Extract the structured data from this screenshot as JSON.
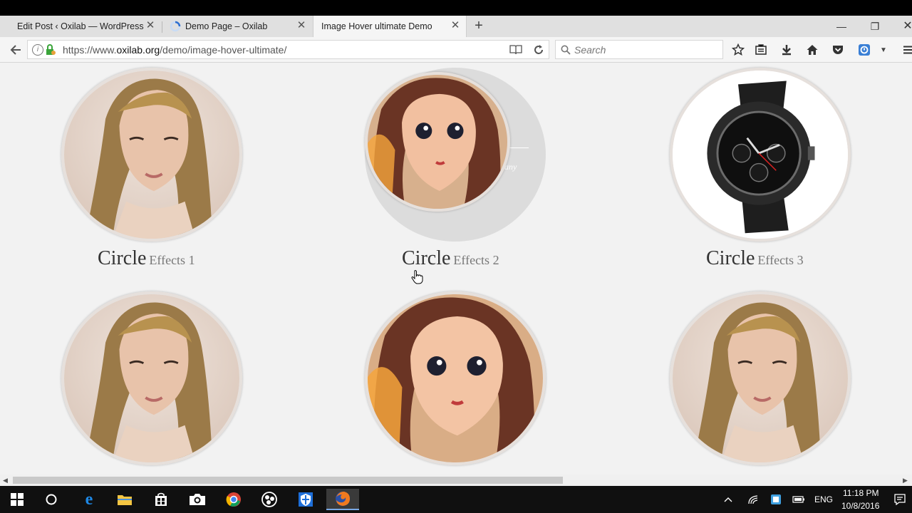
{
  "tabs": [
    {
      "title": "Edit Post ‹ Oxilab — WordPress"
    },
    {
      "title": "Demo Page – Oxilab"
    },
    {
      "title": "Image Hover ultimate Demo"
    }
  ],
  "toolbar": {
    "url_prefix": "https://www.",
    "url_domain": "oxilab.org",
    "url_path": "/demo/image-hover-ultimate/",
    "search_placeholder": "Search"
  },
  "items": [
    {
      "title": "Circle",
      "subtitle": "Effects 1"
    },
    {
      "title": "Circle",
      "subtitle": "Effects 2"
    },
    {
      "title": "Circle",
      "subtitle": "Effects 3"
    }
  ],
  "overlay_text": "any",
  "taskbar": {
    "language": "ENG",
    "time": "11:18 PM",
    "date": "10/8/2016"
  },
  "colors": {
    "page_bg": "#f2f2f2",
    "accent": "#2e6fd0",
    "taskbar": "#101010"
  }
}
